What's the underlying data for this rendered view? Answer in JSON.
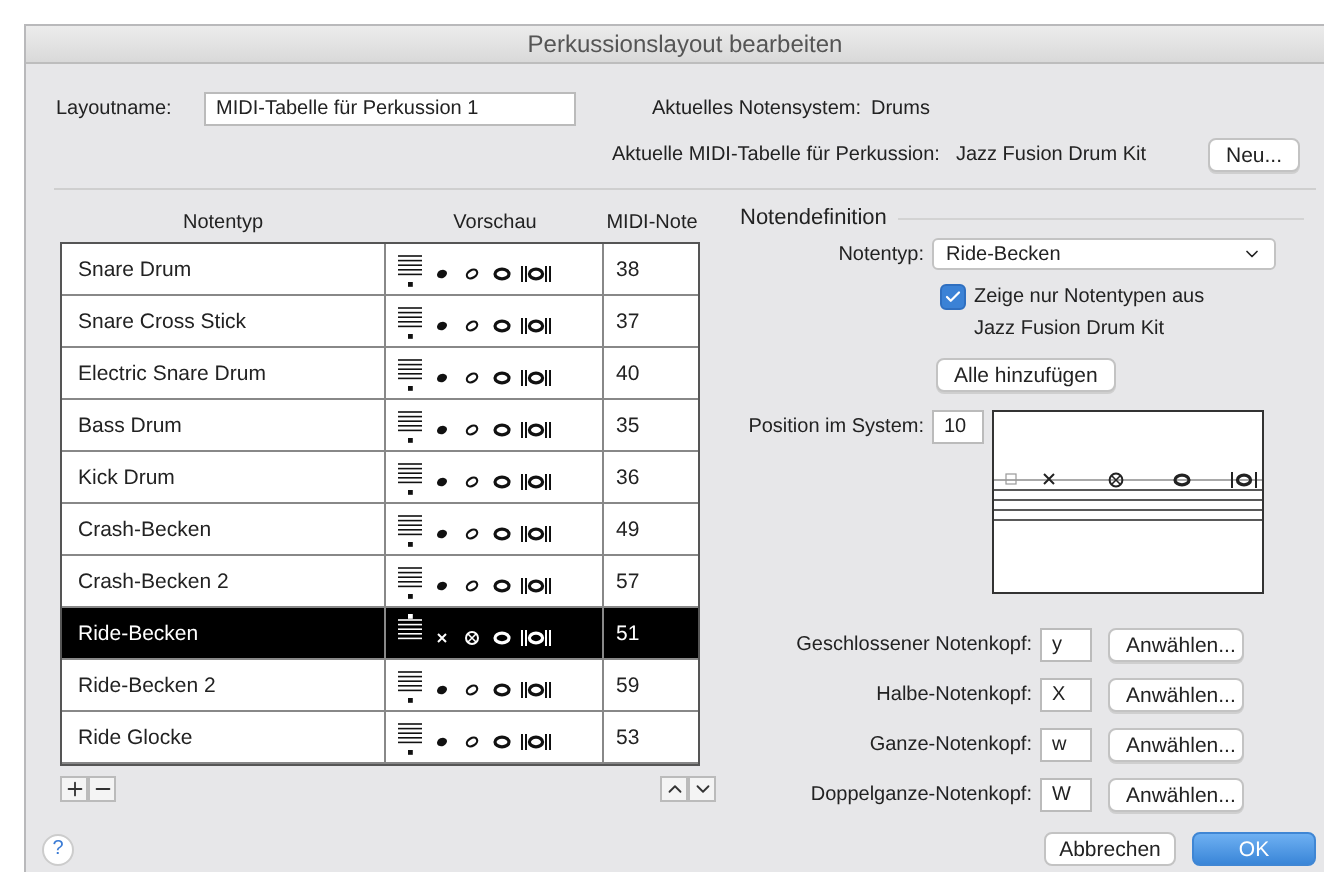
{
  "window": {
    "title": "Perkussionslayout bearbeiten"
  },
  "layout_name": {
    "label": "Layoutname:",
    "value": "MIDI-Tabelle für Perkussion 1"
  },
  "current_staff": {
    "label": "Aktuelles Notensystem:",
    "value": "Drums"
  },
  "current_table": {
    "label": "Aktuelle MIDI-Tabelle für Perkussion:",
    "value": "Jazz Fusion Drum Kit"
  },
  "new_button": "Neu...",
  "table": {
    "columns": [
      "Notentyp",
      "Vorschau",
      "MIDI-Note"
    ],
    "rows": [
      {
        "name": "Snare Drum",
        "note": "38",
        "kind": "normal",
        "selected": false
      },
      {
        "name": "Snare Cross Stick",
        "note": "37",
        "kind": "normal",
        "selected": false
      },
      {
        "name": "Electric Snare Drum",
        "note": "40",
        "kind": "normal",
        "selected": false
      },
      {
        "name": "Bass Drum",
        "note": "35",
        "kind": "normal",
        "selected": false
      },
      {
        "name": "Kick Drum",
        "note": "36",
        "kind": "normal",
        "selected": false
      },
      {
        "name": "Crash-Becken",
        "note": "49",
        "kind": "normal",
        "selected": false
      },
      {
        "name": "Crash-Becken 2",
        "note": "57",
        "kind": "normal",
        "selected": false
      },
      {
        "name": "Ride-Becken",
        "note": "51",
        "kind": "x",
        "selected": true
      },
      {
        "name": "Ride-Becken 2",
        "note": "59",
        "kind": "normal",
        "selected": false
      },
      {
        "name": "Ride Glocke",
        "note": "53",
        "kind": "normal",
        "selected": false
      }
    ]
  },
  "definition": {
    "title": "Notendefinition",
    "type_label": "Notentyp:",
    "type_value": "Ride-Becken",
    "filter": {
      "label": "Zeige nur Notentypen aus Jazz Fusion Drum Kit",
      "checked": true
    },
    "add_all": "Alle hinzufügen",
    "position": {
      "label": "Position im System:",
      "value": "10"
    },
    "noteheads": [
      {
        "label": "Geschlossener Notenkopf:",
        "value": "y",
        "button": "Anwählen..."
      },
      {
        "label": "Halbe-Notenkopf:",
        "value": "X",
        "button": "Anwählen..."
      },
      {
        "label": "Ganze-Notenkopf:",
        "value": "w",
        "button": "Anwählen..."
      },
      {
        "label": "Doppelganze-Notenkopf:",
        "value": "W",
        "button": "Anwählen..."
      }
    ]
  },
  "help_button": "?",
  "buttons": [
    {
      "label": "Abbrechen",
      "kind": "cancel"
    },
    {
      "label": "OK",
      "kind": "default"
    }
  ]
}
